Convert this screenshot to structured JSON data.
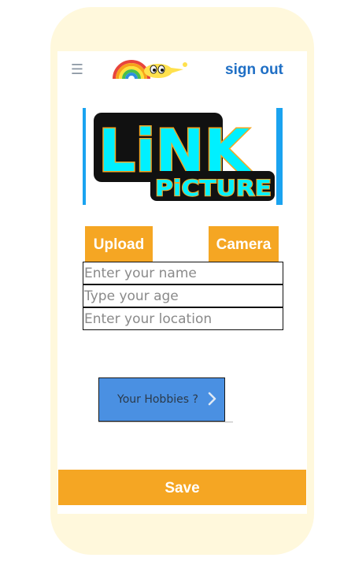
{
  "header": {
    "menu_icon": "hamburger-menu-icon",
    "logo_icon": "rainbow-cartoon-logo",
    "signout_label": "sign out"
  },
  "banner": {
    "line1": "LiNK",
    "line2": "PiCTURE"
  },
  "photo_actions": {
    "upload_label": "Upload",
    "camera_label": "Camera"
  },
  "form": {
    "name_placeholder": "Enter your name",
    "age_placeholder": "Type your age",
    "location_placeholder": "Enter your location"
  },
  "hobbies": {
    "label": "Your Hobbies ?",
    "icon": "chevron-right-icon"
  },
  "footer": {
    "save_label": "Save"
  },
  "colors": {
    "accent_orange": "#f5a623",
    "link_blue": "#1f6fc5",
    "hobbies_blue": "#4a90e2",
    "frame_cream": "#fff8dc",
    "banner_cyan": "#00f0ff",
    "banner_edge_blue": "#1aa3f0"
  }
}
